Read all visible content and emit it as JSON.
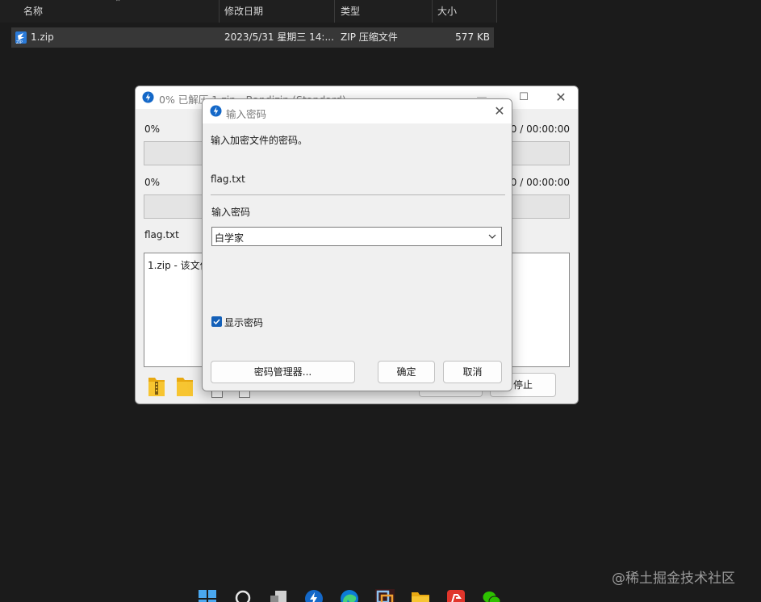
{
  "explorer": {
    "columns": {
      "name": "名称",
      "date": "修改日期",
      "type": "类型",
      "size": "大小"
    },
    "files": [
      {
        "name": "1.zip",
        "date": "2023/5/31 星期三 14:...",
        "type": "ZIP 压缩文件",
        "size": "577 KB"
      }
    ]
  },
  "main_window": {
    "title": "0% 已解压 1.zip - Bandizip (Standard)",
    "total_percent": "0%",
    "total_time": "00:00:00 / 00:00:00",
    "file_percent": "0%",
    "file_time": "00:00:00 / 00:00:00",
    "progress_total": 0,
    "progress_file": 0,
    "current_file": "flag.txt",
    "log_text": "1.zip - 该文件",
    "stop_label": "停止"
  },
  "dialog": {
    "title": "输入密码",
    "prompt": "输入加密文件的密码。",
    "filename": "flag.txt",
    "password_label": "输入密码",
    "password_value": "白学家",
    "show_password_label": "显示密码",
    "show_password_checked": true,
    "password_manager_label": "密码管理器...",
    "ok_label": "确定",
    "cancel_label": "取消"
  },
  "watermark": "@稀土掘金技术社区",
  "taskbar": {
    "icons": [
      "windows-start-icon",
      "search-icon",
      "task-view-icon",
      "bandizip-icon",
      "edge-icon",
      "vmware-icon",
      "file-explorer-icon",
      "wps-icon",
      "wechat-icon"
    ]
  },
  "colors": {
    "accent": "#1460b8",
    "progress": "#06b025",
    "desktop_bg": "#1b1b1b"
  }
}
